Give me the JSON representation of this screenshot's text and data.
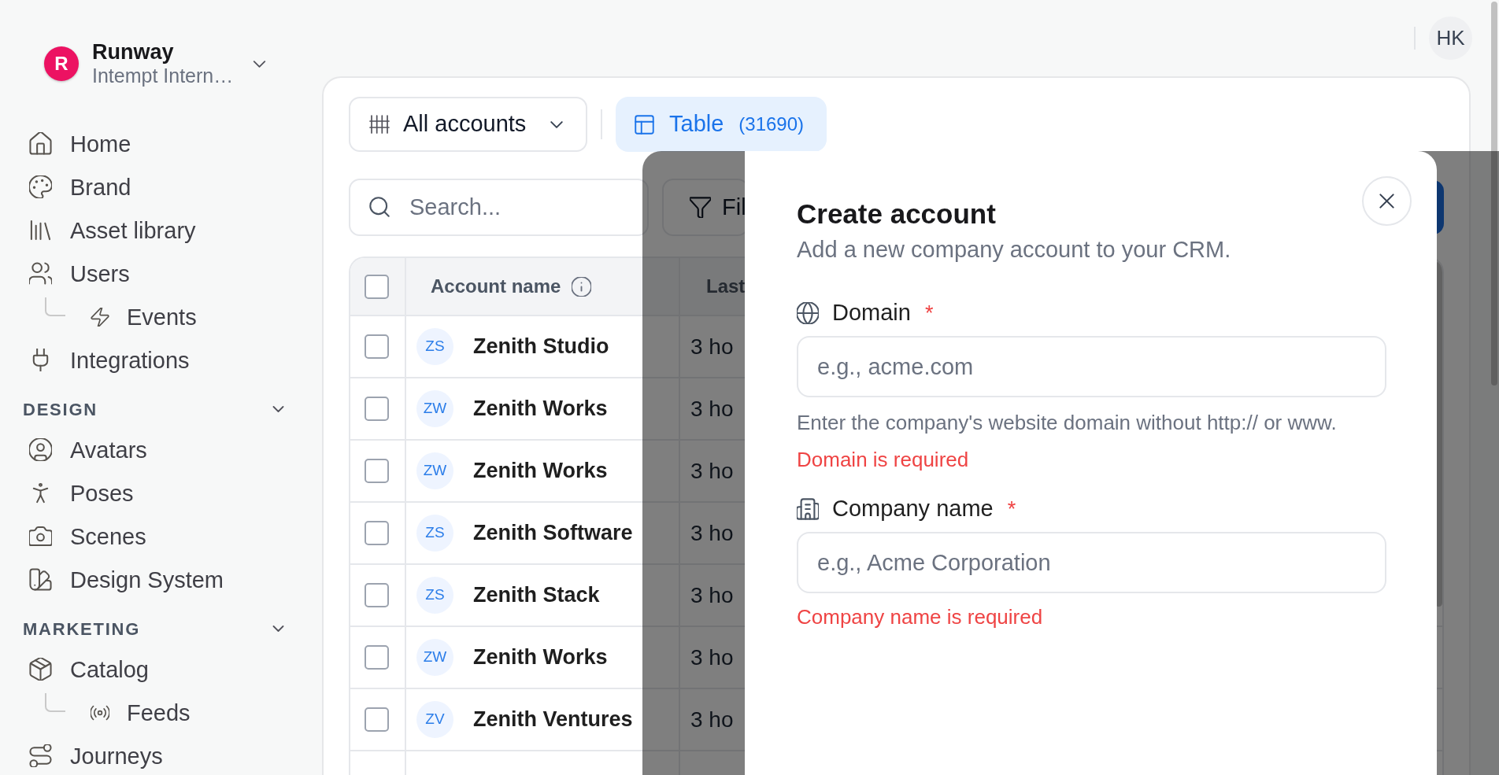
{
  "workspace": {
    "initial": "R",
    "name": "Runway",
    "organization": "Intempt Intern…"
  },
  "user": {
    "initials": "HK"
  },
  "sidebar": {
    "groups": [
      {
        "items": [
          {
            "label": "Home",
            "selected": false
          },
          {
            "label": "Brand",
            "selected": false
          },
          {
            "label": "Asset library",
            "selected": false
          },
          {
            "label": "Users",
            "selected": false,
            "children": [
              {
                "label": "Events",
                "selected": false
              }
            ]
          },
          {
            "label": "Integrations",
            "selected": false
          }
        ]
      },
      {
        "title": "DESIGN",
        "expanded": true,
        "items": [
          {
            "label": "Avatars",
            "selected": false
          },
          {
            "label": "Poses",
            "selected": false
          },
          {
            "label": "Scenes",
            "selected": false
          },
          {
            "label": "Design System",
            "selected": false
          }
        ]
      },
      {
        "title": "MARKETING",
        "expanded": true,
        "items": [
          {
            "label": "Catalog",
            "selected": false,
            "children": [
              {
                "label": "Feeds",
                "selected": false
              }
            ]
          },
          {
            "label": "Journeys",
            "selected": false
          }
        ]
      }
    ]
  },
  "toolbar": {
    "view_menu": {
      "label": "All accounts"
    },
    "view_tabs": [
      {
        "label": "Table",
        "count": "(31690)",
        "selected": true
      }
    ]
  },
  "search": {
    "placeholder": "Search..."
  },
  "filter_button": {
    "label": "Fil"
  },
  "table": {
    "select_all": {
      "checked": false
    },
    "columns": [
      {
        "label": "Account name"
      },
      {
        "label": "Last"
      }
    ],
    "rows": [
      {
        "checked": false,
        "initials": "ZS",
        "name": "Zenith Studio",
        "column_3": "3 ho"
      },
      {
        "checked": false,
        "initials": "ZW",
        "name": "Zenith Works",
        "column_3": "3 ho"
      },
      {
        "checked": false,
        "initials": "ZW",
        "name": "Zenith Works",
        "column_3": "3 ho"
      },
      {
        "checked": false,
        "initials": "ZS",
        "name": "Zenith Software",
        "column_3": "3 ho"
      },
      {
        "checked": false,
        "initials": "ZS",
        "name": "Zenith Stack",
        "column_3": "3 ho"
      },
      {
        "checked": false,
        "initials": "ZW",
        "name": "Zenith Works",
        "column_3": "3 ho"
      },
      {
        "checked": false,
        "initials": "ZV",
        "name": "Zenith Ventures",
        "column_3": "3 ho"
      }
    ]
  },
  "dialog": {
    "title": "Create account",
    "subtitle": "Add a new company account to your CRM.",
    "fields": [
      {
        "label": "Domain",
        "required_mark": "*",
        "placeholder": "e.g., acme.com",
        "help": "Enter the company's website domain without http:// or www.",
        "error": "Domain is required"
      },
      {
        "label": "Company name",
        "required_mark": "*",
        "placeholder": "e.g., Acme Corporation",
        "error": "Company name is required"
      }
    ]
  }
}
